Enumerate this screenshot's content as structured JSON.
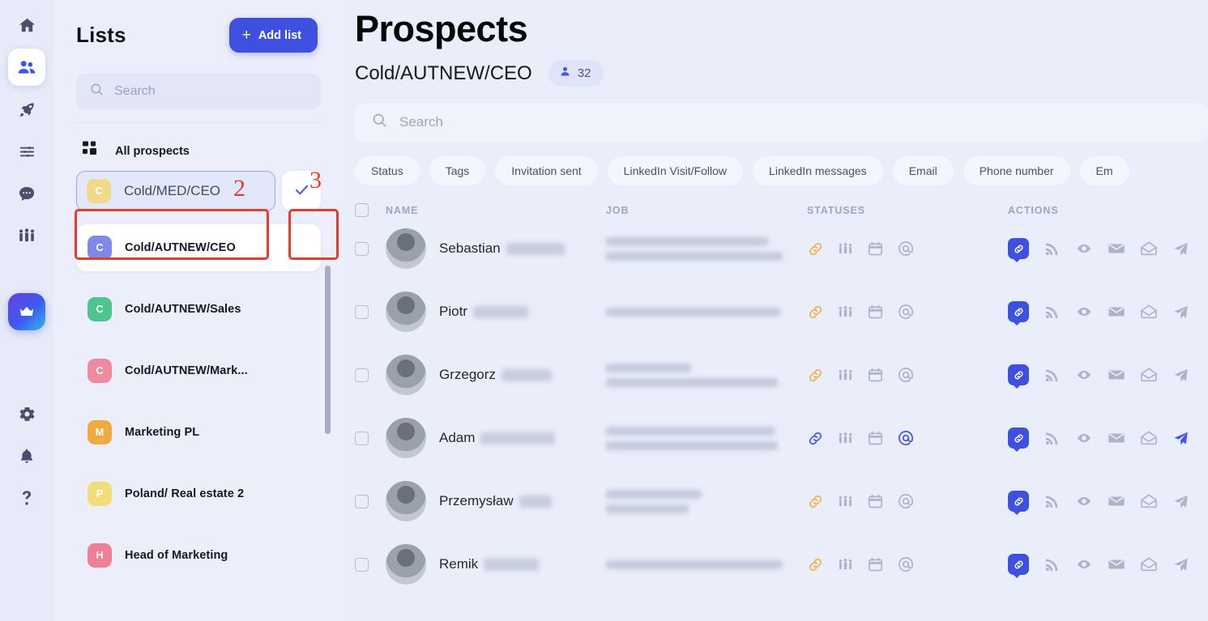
{
  "rail": {
    "items": [
      {
        "icon": "home-icon",
        "name": "rail-item-home",
        "active": false
      },
      {
        "icon": "people-icon",
        "name": "rail-item-prospects",
        "active": true
      },
      {
        "icon": "rocket-icon",
        "name": "rail-item-campaigns",
        "active": false
      },
      {
        "icon": "sliders-icon",
        "name": "rail-item-filters",
        "active": false
      },
      {
        "icon": "chat-bubble-icon",
        "name": "rail-item-inbox",
        "active": false
      },
      {
        "icon": "team-icon",
        "name": "rail-item-team",
        "active": false
      },
      {
        "icon": "crown-icon",
        "name": "rail-item-upgrade",
        "active": false
      },
      {
        "icon": "gear-icon",
        "name": "rail-item-settings",
        "active": false
      },
      {
        "icon": "bell-icon",
        "name": "rail-item-notifications",
        "active": false
      },
      {
        "icon": "question-mark-icon",
        "name": "rail-item-help",
        "active": false
      }
    ]
  },
  "sidebar": {
    "title": "Lists",
    "add_button_label": "Add list",
    "add_button_plus": "+",
    "search_placeholder": "Search",
    "all_prospects_label": "All prospects",
    "editing_item": {
      "initial": "C",
      "value": "Cold/MED/CEO",
      "color": "#f0da8a"
    },
    "items": [
      {
        "initial": "C",
        "label": "Cold/AUTNEW/CEO",
        "color": "#7f8ae8",
        "highlighted": true
      },
      {
        "initial": "C",
        "label": "Cold/AUTNEW/Sales",
        "color": "#4ec58d",
        "highlighted": false
      },
      {
        "initial": "C",
        "label": "Cold/AUTNEW/Mark...",
        "color": "#ef8a9f",
        "highlighted": false
      },
      {
        "initial": "M",
        "label": "Marketing PL",
        "color": "#eeab3f",
        "highlighted": false
      },
      {
        "initial": "P",
        "label": "Poland/ Real estate 2",
        "color": "#f3dd78",
        "highlighted": false
      },
      {
        "initial": "H",
        "label": "Head of Marketing",
        "color": "#ef7f95",
        "highlighted": false
      }
    ]
  },
  "annotations": [
    {
      "label": "2",
      "target": "edit-list-name-field"
    },
    {
      "label": "3",
      "target": "confirm-list-name-button"
    }
  ],
  "main": {
    "page_title": "Prospects",
    "list_name": "Cold/AUTNEW/CEO",
    "count_badge": "32",
    "search_placeholder": "Search",
    "filter_chips": [
      "Status",
      "Tags",
      "Invitation sent",
      "LinkedIn Visit/Follow",
      "LinkedIn messages",
      "Email",
      "Phone number",
      "Em"
    ],
    "columns": [
      "NAME",
      "JOB",
      "STATUSES",
      "ACTIONS"
    ],
    "rows": [
      {
        "first_name": "Sebastian",
        "last_name_redacted_width": 72,
        "job_line_widths": [
          200,
          218
        ],
        "statuses": [
          {
            "icon": "link-icon",
            "state": "orange"
          },
          {
            "icon": "group-icon",
            "state": "gray"
          },
          {
            "icon": "calendar-icon",
            "state": "gray"
          },
          {
            "icon": "at-icon",
            "state": "gray"
          }
        ],
        "actions": [
          {
            "icon": "link-bubble-icon",
            "state": "blue"
          },
          {
            "icon": "rss-icon",
            "state": "gray"
          },
          {
            "icon": "eye-icon",
            "state": "gray"
          },
          {
            "icon": "envelope-closed-icon",
            "state": "gray"
          },
          {
            "icon": "envelope-open-icon",
            "state": "gray"
          },
          {
            "icon": "paper-plane-icon",
            "state": "gray"
          }
        ]
      },
      {
        "first_name": "Piotr",
        "last_name_redacted_width": 68,
        "job_line_widths": [
          215
        ],
        "statuses": [
          {
            "icon": "link-icon",
            "state": "orange"
          },
          {
            "icon": "group-icon",
            "state": "gray"
          },
          {
            "icon": "calendar-icon",
            "state": "gray"
          },
          {
            "icon": "at-icon",
            "state": "gray"
          }
        ],
        "actions": [
          {
            "icon": "link-bubble-icon",
            "state": "blue"
          },
          {
            "icon": "rss-icon",
            "state": "gray"
          },
          {
            "icon": "eye-icon",
            "state": "gray"
          },
          {
            "icon": "envelope-closed-icon",
            "state": "gray"
          },
          {
            "icon": "envelope-open-icon",
            "state": "gray"
          },
          {
            "icon": "paper-plane-icon",
            "state": "gray"
          }
        ]
      },
      {
        "first_name": "Grzegorz",
        "last_name_redacted_width": 62,
        "job_line_widths": [
          105,
          212
        ],
        "statuses": [
          {
            "icon": "link-icon",
            "state": "orange"
          },
          {
            "icon": "group-icon",
            "state": "gray"
          },
          {
            "icon": "calendar-icon",
            "state": "gray"
          },
          {
            "icon": "at-icon",
            "state": "gray"
          }
        ],
        "actions": [
          {
            "icon": "link-bubble-icon",
            "state": "blue"
          },
          {
            "icon": "rss-icon",
            "state": "gray"
          },
          {
            "icon": "eye-icon",
            "state": "gray"
          },
          {
            "icon": "envelope-closed-icon",
            "state": "gray"
          },
          {
            "icon": "envelope-open-icon",
            "state": "gray"
          },
          {
            "icon": "paper-plane-icon",
            "state": "gray"
          }
        ]
      },
      {
        "first_name": "Adam",
        "last_name_redacted_width": 92,
        "job_line_widths": [
          208,
          212
        ],
        "statuses": [
          {
            "icon": "link-icon",
            "state": "blue"
          },
          {
            "icon": "group-icon",
            "state": "gray"
          },
          {
            "icon": "calendar-icon",
            "state": "gray"
          },
          {
            "icon": "at-icon",
            "state": "blue"
          }
        ],
        "actions": [
          {
            "icon": "link-bubble-icon",
            "state": "blue"
          },
          {
            "icon": "rss-icon",
            "state": "gray"
          },
          {
            "icon": "eye-icon",
            "state": "gray"
          },
          {
            "icon": "envelope-closed-icon",
            "state": "gray"
          },
          {
            "icon": "envelope-open-icon",
            "state": "gray"
          },
          {
            "icon": "paper-plane-icon",
            "state": "blue"
          }
        ]
      },
      {
        "first_name": "Przemysław",
        "last_name_redacted_width": 40,
        "job_line_widths": [
          118,
          102
        ],
        "statuses": [
          {
            "icon": "link-icon",
            "state": "orange"
          },
          {
            "icon": "group-icon",
            "state": "gray"
          },
          {
            "icon": "calendar-icon",
            "state": "gray"
          },
          {
            "icon": "at-icon",
            "state": "gray"
          }
        ],
        "actions": [
          {
            "icon": "link-bubble-icon",
            "state": "blue"
          },
          {
            "icon": "rss-icon",
            "state": "gray"
          },
          {
            "icon": "eye-icon",
            "state": "gray"
          },
          {
            "icon": "envelope-closed-icon",
            "state": "gray"
          },
          {
            "icon": "envelope-open-icon",
            "state": "gray"
          },
          {
            "icon": "paper-plane-icon",
            "state": "gray"
          }
        ]
      },
      {
        "first_name": "Remik",
        "last_name_redacted_width": 68,
        "job_line_widths": [
          218
        ],
        "statuses": [
          {
            "icon": "link-icon",
            "state": "orange"
          },
          {
            "icon": "group-icon",
            "state": "gray"
          },
          {
            "icon": "calendar-icon",
            "state": "gray"
          },
          {
            "icon": "at-icon",
            "state": "gray"
          }
        ],
        "actions": [
          {
            "icon": "link-bubble-icon",
            "state": "blue"
          },
          {
            "icon": "rss-icon",
            "state": "gray"
          },
          {
            "icon": "eye-icon",
            "state": "gray"
          },
          {
            "icon": "envelope-closed-icon",
            "state": "gray"
          },
          {
            "icon": "envelope-open-icon",
            "state": "gray"
          },
          {
            "icon": "paper-plane-icon",
            "state": "gray"
          }
        ]
      }
    ]
  },
  "colors": {
    "accent": "#3d50e0",
    "bg": "#eaedfa",
    "annotation": "#e33d2e",
    "status_orange": "#efb34a",
    "status_gray": "#aeb3c9"
  }
}
